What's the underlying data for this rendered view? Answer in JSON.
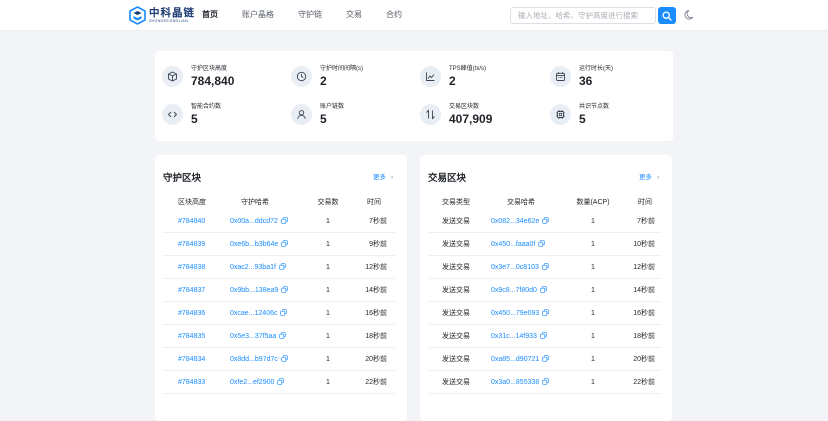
{
  "header": {
    "logo_cn": "中科晶链",
    "logo_en": "ZHONGKEJINGLIAN",
    "nav": [
      "首页",
      "账户晶格",
      "守护链",
      "交易",
      "合约"
    ],
    "active_nav": "首页",
    "search_placeholder": "输入地址、哈希、守护高度进行搜索"
  },
  "stats": [
    {
      "label": "守护区块高度",
      "value": "784,840",
      "icon": "cube-icon"
    },
    {
      "label": "守护时间间隔(s)",
      "value": "2",
      "icon": "clock-icon"
    },
    {
      "label": "TPS峰值(tx/s)",
      "value": "2",
      "icon": "chart-line-icon"
    },
    {
      "label": "运行时长(天)",
      "value": "36",
      "icon": "calendar-icon"
    },
    {
      "label": "智能合约数",
      "value": "5",
      "icon": "code-icon"
    },
    {
      "label": "账户链数",
      "value": "5",
      "icon": "user-icon"
    },
    {
      "label": "交易区块数",
      "value": "407,909",
      "icon": "transfer-icon"
    },
    {
      "label": "共识节点数",
      "value": "5",
      "icon": "chip-icon"
    }
  ],
  "guard_blocks": {
    "title": "守护区块",
    "more": "更多",
    "columns": [
      "区块高度",
      "守护哈希",
      "交易数",
      "时间"
    ],
    "rows": [
      {
        "height": "#784840",
        "hash": "0x00a...ddcd72",
        "tx": "1",
        "time": "7秒前"
      },
      {
        "height": "#784839",
        "hash": "0xe6b...b3b64e",
        "tx": "1",
        "time": "9秒前"
      },
      {
        "height": "#784838",
        "hash": "0xac2...93ba1f",
        "tx": "1",
        "time": "12秒前"
      },
      {
        "height": "#784837",
        "hash": "0x9bb...138ea9",
        "tx": "1",
        "time": "14秒前"
      },
      {
        "height": "#784836",
        "hash": "0xcae...12406c",
        "tx": "1",
        "time": "16秒前"
      },
      {
        "height": "#784835",
        "hash": "0x5e3...37f5aa",
        "tx": "1",
        "time": "18秒前"
      },
      {
        "height": "#784834",
        "hash": "0x8dd...b97d7c",
        "tx": "1",
        "time": "20秒前"
      },
      {
        "height": "#784833",
        "hash": "0xfe2...ef2900",
        "tx": "1",
        "time": "22秒前"
      }
    ]
  },
  "tx_blocks": {
    "title": "交易区块",
    "more": "更多",
    "columns": [
      "交易类型",
      "交易哈希",
      "数量(ACP)",
      "时间"
    ],
    "rows": [
      {
        "type": "发送交易",
        "hash": "0x082...34e62e",
        "amount": "1",
        "time": "7秒前"
      },
      {
        "type": "发送交易",
        "hash": "0x450...faaa0f",
        "amount": "1",
        "time": "10秒前"
      },
      {
        "type": "发送交易",
        "hash": "0x3e7...0c8103",
        "amount": "1",
        "time": "12秒前"
      },
      {
        "type": "发送交易",
        "hash": "0x9c8...7f80d0",
        "amount": "1",
        "time": "14秒前"
      },
      {
        "type": "发送交易",
        "hash": "0x450...79e093",
        "amount": "1",
        "time": "16秒前"
      },
      {
        "type": "发送交易",
        "hash": "0x31c...14f933",
        "amount": "1",
        "time": "18秒前"
      },
      {
        "type": "发送交易",
        "hash": "0xa85...d90721",
        "amount": "1",
        "time": "20秒前"
      },
      {
        "type": "发送交易",
        "hash": "0x3a0...855338",
        "amount": "1",
        "time": "22秒前"
      }
    ]
  },
  "colors": {
    "accent": "#1a8cff",
    "brand": "#1b3a72",
    "background": "#f2f4f7"
  }
}
